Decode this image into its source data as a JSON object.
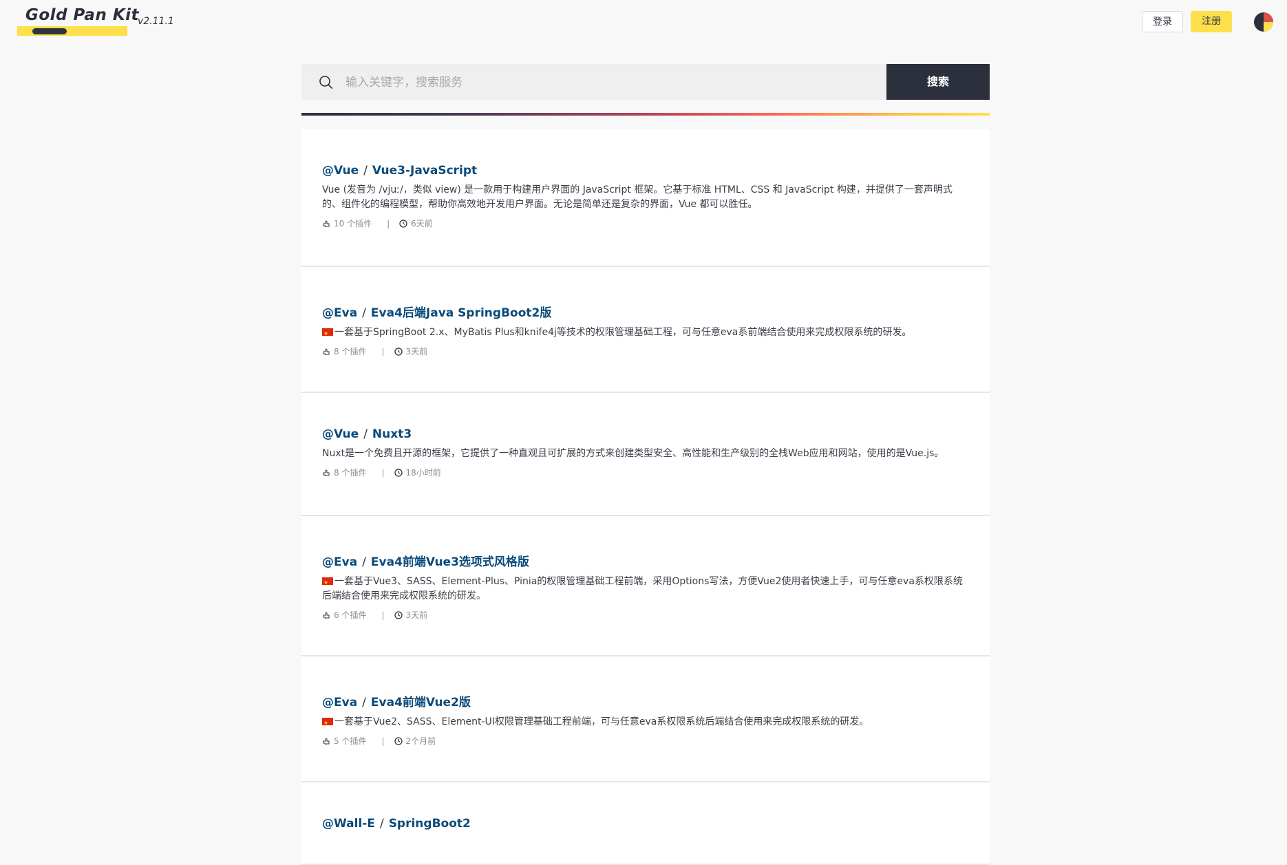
{
  "header": {
    "logo_text": "Gold Pan Kit",
    "version": "v2.11.1",
    "login_label": "登录",
    "register_label": "注册"
  },
  "search": {
    "placeholder": "输入关键字，搜索服务",
    "button_label": "搜索"
  },
  "services": [
    {
      "owner": "@Vue",
      "name": "Vue3-JavaScript",
      "flag": false,
      "description": "Vue (发音为 /vjuː/，类似 view) 是一款用于构建用户界面的 JavaScript 框架。它基于标准 HTML、CSS 和 JavaScript 构建，并提供了一套声明式的、组件化的编程模型，帮助你高效地开发用户界面。无论是简单还是复杂的界面，Vue 都可以胜任。",
      "plugins": "10 个插件",
      "updated": "6天前"
    },
    {
      "owner": "@Eva",
      "name": "Eva4后端Java SpringBoot2版",
      "flag": true,
      "description": "一套基于SpringBoot 2.x、MyBatis Plus和knife4j等技术的权限管理基础工程，可与任意eva系前端结合使用来完成权限系统的研发。",
      "plugins": "8 个插件",
      "updated": "3天前"
    },
    {
      "owner": "@Vue",
      "name": "Nuxt3",
      "flag": false,
      "description": "Nuxt是一个免费且开源的框架，它提供了一种直观且可扩展的方式来创建类型安全、高性能和生产级别的全栈Web应用和网站，使用的是Vue.js。",
      "plugins": "8 个插件",
      "updated": "18小时前"
    },
    {
      "owner": "@Eva",
      "name": "Eva4前端Vue3选项式风格版",
      "flag": true,
      "description": "一套基于Vue3、SASS、Element-Plus、Pinia的权限管理基础工程前端，采用Options写法，方便Vue2使用者快速上手，可与任意eva系权限系统后端结合使用来完成权限系统的研发。",
      "plugins": "6 个插件",
      "updated": "3天前"
    },
    {
      "owner": "@Eva",
      "name": "Eva4前端Vue2版",
      "flag": true,
      "description": "一套基于Vue2、SASS、Element-UI权限管理基础工程前端，可与任意eva系权限系统后端结合使用来完成权限系统的研发。",
      "plugins": "5 个插件",
      "updated": "2个月前"
    },
    {
      "owner": "@Wall-E",
      "name": "SpringBoot2",
      "flag": false,
      "description": "",
      "plugins": "",
      "updated": ""
    }
  ],
  "colors": {
    "accent": "#fde04b",
    "dark": "#2b303c",
    "title": "#0b4a7a"
  }
}
